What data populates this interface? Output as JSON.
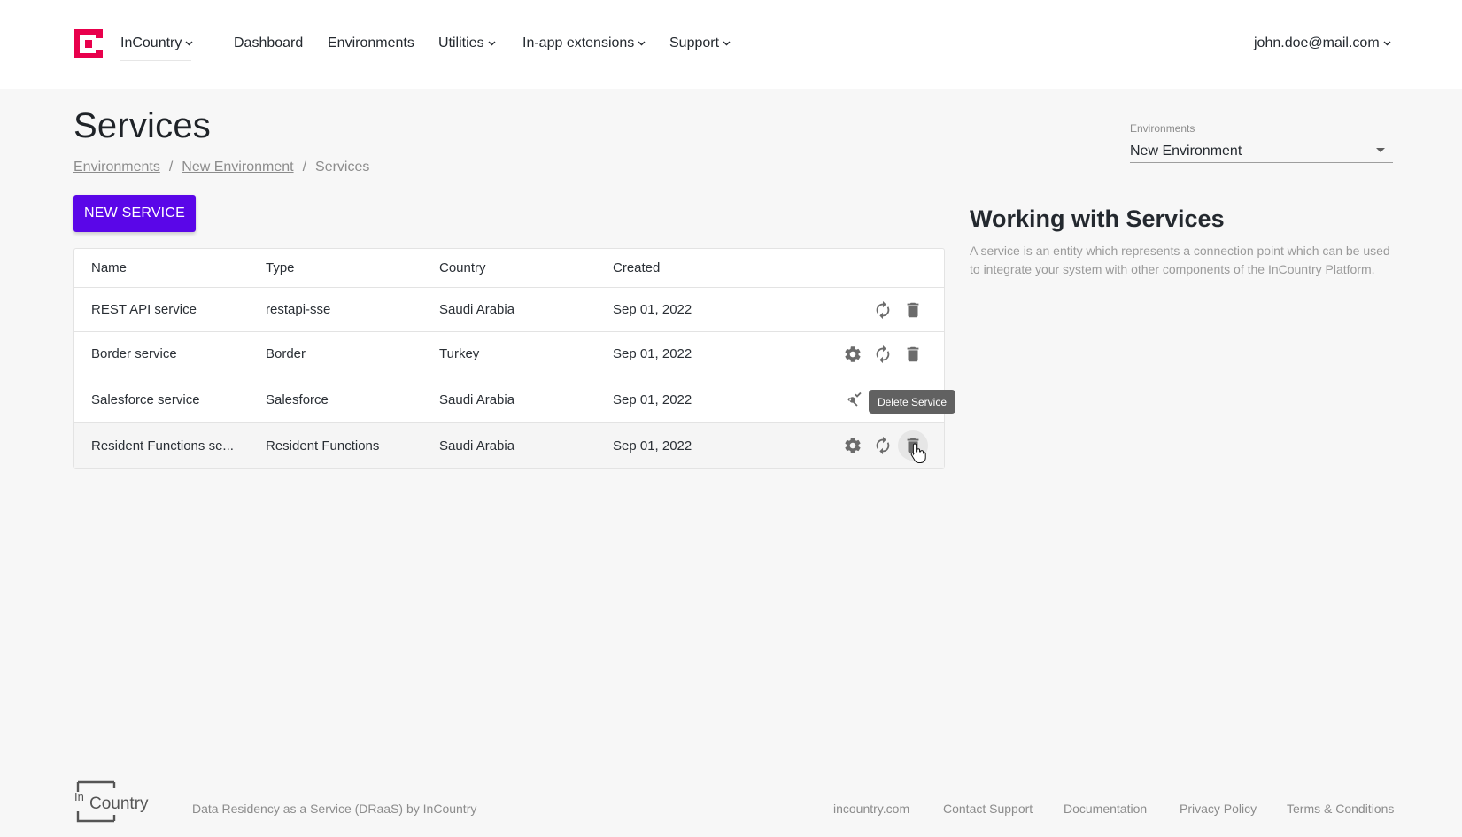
{
  "header": {
    "org_name": "InCountry",
    "nav": [
      {
        "label": "Dashboard"
      },
      {
        "label": "Environments"
      },
      {
        "label": "Utilities"
      },
      {
        "label": "In-app extensions"
      },
      {
        "label": "Support"
      }
    ],
    "user_email": "john.doe@mail.com"
  },
  "page": {
    "title": "Services",
    "breadcrumb": [
      "Environments",
      "New Environment",
      "Services"
    ],
    "new_button_label": "NEW SERVICE"
  },
  "table": {
    "columns": [
      "Name",
      "Type",
      "Country",
      "Created"
    ],
    "rows": [
      {
        "name": "REST API service",
        "type": "restapi-sse",
        "country": "Saudi Arabia",
        "created": "Sep 01, 2022"
      },
      {
        "name": "Border service",
        "type": "Border",
        "country": "Turkey",
        "created": "Sep 01, 2022"
      },
      {
        "name": "Salesforce service",
        "type": "Salesforce",
        "country": "Saudi Arabia",
        "created": "Sep 01, 2022"
      },
      {
        "name": "Resident Functions se...",
        "type": "Resident Functions",
        "country": "Saudi Arabia",
        "created": "Sep 01, 2022"
      }
    ]
  },
  "tooltip": {
    "text": "Delete Service"
  },
  "environments_select": {
    "label": "Environments",
    "value": "New Environment"
  },
  "info": {
    "title": "Working with Services",
    "text": "A service is an entity which represents a connection point which can be used to integrate your system with other components of the InCountry Platform."
  },
  "footer": {
    "description": "Data Residency as a Service (DRaaS) by InCountry",
    "links": [
      "incountry.com",
      "Contact Support",
      "Documentation",
      "Privacy Policy",
      "Terms & Conditions"
    ],
    "logo_text": {
      "prefix": "In",
      "main": "Country"
    }
  },
  "colors": {
    "accent": "#5a06e8",
    "brand": "#e8004c"
  }
}
